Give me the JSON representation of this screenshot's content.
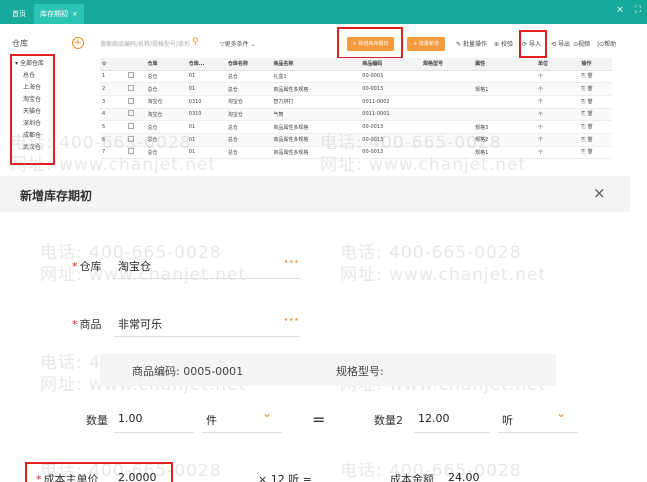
{
  "topbar": {
    "home_tab": "首页",
    "active_tab": "库存期初",
    "close_x": "×",
    "icon_close": "×",
    "icon_expand": "⛶"
  },
  "tree": {
    "title": "仓库",
    "add": "+",
    "items": [
      "全部仓库",
      "总仓",
      "上海仓",
      "淘宝仓",
      "天猫仓",
      "深圳仓",
      "成都仓",
      "武汉仓"
    ]
  },
  "search": {
    "placeholder": "搜索商品编码/名称/规格型号/条形",
    "more": "更多条件"
  },
  "toolbar": {
    "new_label": "+ 新增库存期初",
    "batch_label": "+ 批量新增",
    "batch_op": "批量操作",
    "check": "校验",
    "import": "导入",
    "export": "导出",
    "video": "视频",
    "help": "帮助"
  },
  "table": {
    "headers": [
      "",
      "",
      "仓库",
      "仓库...",
      "仓库名称",
      "商品名称",
      "商品编码",
      "规格型号",
      "属性",
      "单位",
      "操作"
    ],
    "rows": [
      [
        "1",
        "总仓",
        "01",
        "总仓",
        "礼盒1",
        "00-0003",
        "",
        "",
        "个"
      ],
      [
        "2",
        "总仓",
        "01",
        "总仓",
        "商品属性多规格",
        "00-0013",
        "",
        "规格1",
        "个"
      ],
      [
        "3",
        "淘宝仓",
        "0310",
        "淘宝仓",
        "智力拼打",
        "0011-0002",
        "",
        "",
        "个"
      ],
      [
        "4",
        "淘宝仓",
        "0310",
        "淘宝仓",
        "气筒",
        "0011-0001",
        "",
        "",
        "个"
      ],
      [
        "5",
        "总仓",
        "01",
        "总仓",
        "商品属性多规格",
        "00-0013",
        "",
        "规格3",
        "个"
      ],
      [
        "6",
        "总仓",
        "01",
        "总仓",
        "商品属性多规格",
        "00-0013",
        "",
        "规格2",
        "个"
      ],
      [
        "7",
        "总仓",
        "01",
        "总仓",
        "商品属性多规格",
        "00-0013",
        "",
        "规格1",
        "个"
      ]
    ]
  },
  "watermark": {
    "phone": "电话: 400-665-0028",
    "site": "网址: www.chanjet.net"
  },
  "dialog": {
    "title": "新增库存期初",
    "close": "×",
    "warehouse_label": "仓库",
    "warehouse_value": "淘宝仓",
    "product_label": "商品",
    "product_value": "非常可乐",
    "product_code": "商品编码: 0005-0001",
    "spec_label": "规格型号:",
    "qty_label": "数量",
    "qty_value": "1.00",
    "unit1": "件",
    "equals": "=",
    "qty2_label": "数量2",
    "qty2_value": "12.00",
    "unit2": "听",
    "cost_label": "成本主单价",
    "cost_value": "2.0000",
    "conversion": "× 12 听 =",
    "total_label": "成本金额",
    "total_value": "24.00",
    "more_dots": "···",
    "required": "*"
  }
}
